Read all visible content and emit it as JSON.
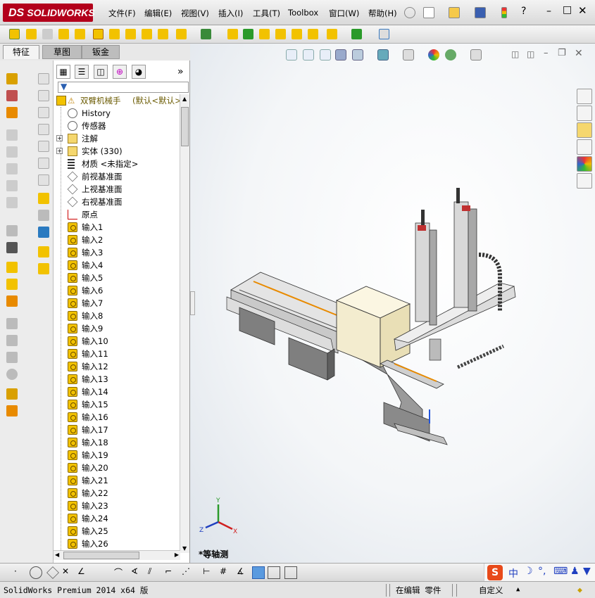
{
  "app": {
    "logo_prefix": "DS",
    "logo_text": "SOLIDWORKS"
  },
  "menu": [
    {
      "label": "文件(F)"
    },
    {
      "label": "编辑(E)"
    },
    {
      "label": "视图(V)"
    },
    {
      "label": "插入(I)"
    },
    {
      "label": "工具(T)"
    },
    {
      "label": "Toolbox"
    },
    {
      "label": "窗口(W)"
    },
    {
      "label": "帮助(H)"
    }
  ],
  "command_tabs": [
    {
      "label": "特征",
      "active": true
    },
    {
      "label": "草图",
      "active": false
    },
    {
      "label": "钣金",
      "active": false
    }
  ],
  "feature_tree": {
    "more_label": "»",
    "root": {
      "label": "双臂机械手",
      "config": "(默认<默认>"
    },
    "items": [
      {
        "label": "History",
        "icon": "history-icon"
      },
      {
        "label": "传感器",
        "icon": "sensor-icon"
      },
      {
        "label": "注解",
        "icon": "annotation-icon",
        "expandable": true
      },
      {
        "label": "实体 (330)",
        "icon": "solid-bodies-icon",
        "expandable": true
      },
      {
        "label": "材质 <未指定>",
        "icon": "material-icon"
      },
      {
        "label": "前视基准面",
        "icon": "plane-icon"
      },
      {
        "label": "上视基准面",
        "icon": "plane-icon"
      },
      {
        "label": "右视基准面",
        "icon": "plane-icon"
      },
      {
        "label": "原点",
        "icon": "origin-icon"
      },
      {
        "label": "输入1",
        "icon": "imported-body-icon"
      },
      {
        "label": "输入2",
        "icon": "imported-body-icon"
      },
      {
        "label": "输入3",
        "icon": "imported-body-icon"
      },
      {
        "label": "输入4",
        "icon": "imported-body-icon"
      },
      {
        "label": "输入5",
        "icon": "imported-body-icon"
      },
      {
        "label": "输入6",
        "icon": "imported-body-icon"
      },
      {
        "label": "输入7",
        "icon": "imported-body-icon"
      },
      {
        "label": "输入8",
        "icon": "imported-body-icon"
      },
      {
        "label": "输入9",
        "icon": "imported-body-icon"
      },
      {
        "label": "输入10",
        "icon": "imported-body-icon"
      },
      {
        "label": "输入11",
        "icon": "imported-body-icon"
      },
      {
        "label": "输入12",
        "icon": "imported-body-icon"
      },
      {
        "label": "输入13",
        "icon": "imported-body-icon"
      },
      {
        "label": "输入14",
        "icon": "imported-body-icon"
      },
      {
        "label": "输入15",
        "icon": "imported-body-icon"
      },
      {
        "label": "输入16",
        "icon": "imported-body-icon"
      },
      {
        "label": "输入17",
        "icon": "imported-body-icon"
      },
      {
        "label": "输入18",
        "icon": "imported-body-icon"
      },
      {
        "label": "输入19",
        "icon": "imported-body-icon"
      },
      {
        "label": "输入20",
        "icon": "imported-body-icon"
      },
      {
        "label": "输入21",
        "icon": "imported-body-icon"
      },
      {
        "label": "输入22",
        "icon": "imported-body-icon"
      },
      {
        "label": "输入23",
        "icon": "imported-body-icon"
      },
      {
        "label": "输入24",
        "icon": "imported-body-icon"
      },
      {
        "label": "输入25",
        "icon": "imported-body-icon"
      },
      {
        "label": "输入26",
        "icon": "imported-body-icon"
      }
    ]
  },
  "graphics": {
    "view_name": "*等轴测",
    "triad": {
      "x": "X",
      "y": "Y",
      "z": "Z"
    }
  },
  "ime": {
    "mode": "中"
  },
  "status": {
    "version": "SolidWorks Premium 2014 x64 版",
    "editing": "在编辑 零件",
    "units": "自定义"
  },
  "colors": {
    "brand": "#b3001b",
    "accent_orange": "#e88a00",
    "icon_yellow": "#f2c200",
    "model_gray": "#8c8c8c",
    "model_box": "#f3eccf"
  }
}
